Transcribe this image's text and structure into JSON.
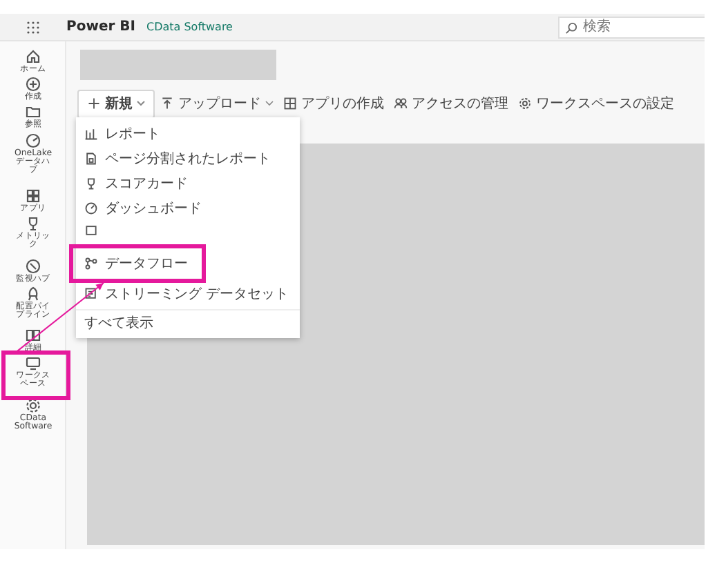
{
  "header": {
    "brand": "Power BI",
    "workspace": "CData Software"
  },
  "search": {
    "placeholder": "検索"
  },
  "rail": [
    {
      "label": "ホーム",
      "kind": "home",
      "highlighted": false
    },
    {
      "label": "作成",
      "kind": "create",
      "highlighted": false
    },
    {
      "label": "参照",
      "kind": "browse",
      "highlighted": false
    },
    {
      "label": "OneLake データハブ",
      "kind": "datahub",
      "highlighted": false
    },
    {
      "label": "アプリ",
      "kind": "apps",
      "highlighted": false
    },
    {
      "label": "メトリック",
      "kind": "metrics",
      "highlighted": false
    },
    {
      "label": "監視ハブ",
      "kind": "monitor",
      "highlighted": false
    },
    {
      "label": "配置パイプライン",
      "kind": "pipeline",
      "highlighted": false
    },
    {
      "label": "詳細",
      "kind": "learn",
      "highlighted": false
    },
    {
      "label": "ワークスペース",
      "kind": "workspace",
      "highlighted": true
    },
    {
      "label": "CData Software",
      "kind": "cdata",
      "highlighted": false
    }
  ],
  "toolbar": [
    {
      "label": "新規",
      "kind": "new",
      "expanded": true
    },
    {
      "label": "アップロード",
      "kind": "upload",
      "expanded": false
    },
    {
      "label": "アプリの作成",
      "kind": "app"
    },
    {
      "label": "アクセスの管理",
      "kind": "access"
    },
    {
      "label": "ワークスペースの設定",
      "kind": "settings"
    }
  ],
  "new_menu": {
    "items": [
      {
        "label": "レポート",
        "kind": "report",
        "highlighted": false
      },
      {
        "label": "ページ分割されたレポート",
        "kind": "paginated",
        "highlighted": false
      },
      {
        "label": "スコアカード",
        "kind": "scorecard",
        "highlighted": false
      },
      {
        "label": "ダッシュボード",
        "kind": "dashboard",
        "highlighted": false
      },
      {
        "kind": "dataset",
        "highlighted": false
      },
      {
        "label": "データフロー",
        "kind": "dataflow",
        "highlighted": true
      },
      {
        "label": "ストリーミング データセット",
        "kind": "streaming",
        "highlighted": false
      }
    ],
    "footer": "すべて表示"
  },
  "annotation": {
    "color": "#e5199c"
  }
}
